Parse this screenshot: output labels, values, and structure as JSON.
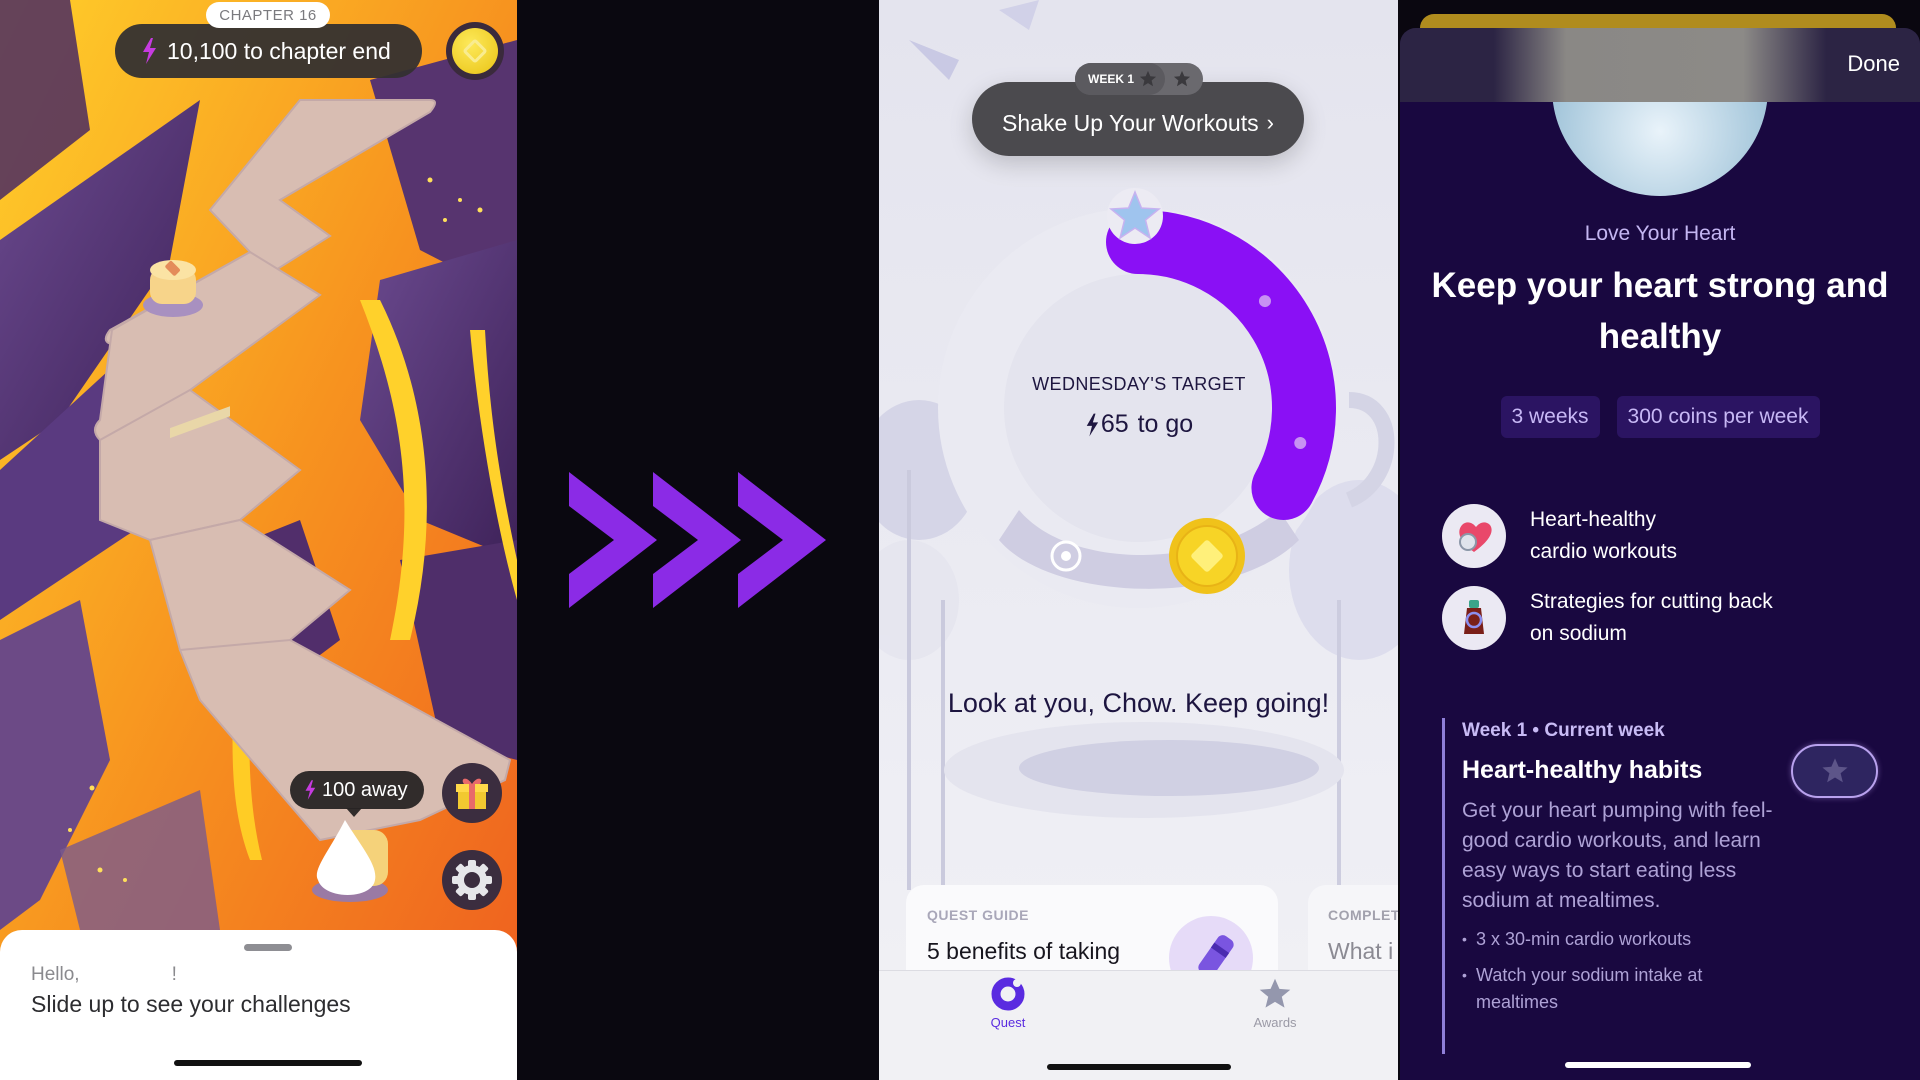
{
  "game": {
    "chapter_label": "CHAPTER 16",
    "progress_text": "10,100 to chapter end",
    "away_text": "100 away",
    "coin_button_icon": "coin-icon",
    "gift_button_icon": "gift-icon",
    "settings_button_icon": "gear-icon",
    "sheet": {
      "greeting": "Hello,",
      "greeting_suffix": "!",
      "prompt": "Slide up to see your challenges"
    },
    "accent_bolt_color": "#c63be0"
  },
  "divider": {
    "icon": "triple-chevron-right-icon",
    "color": "#8b2be6"
  },
  "quest": {
    "week_label": "WEEK 1",
    "title": "Shake Up Your Workouts",
    "title_chevron": "›",
    "target_label": "WEDNESDAY'S TARGET",
    "togo_value": "65",
    "togo_suffix": " to go",
    "ring_progress_fraction": 0.33,
    "ring_color": "#8a10f5",
    "encouragement": "Look at you, Chow. Keep going!",
    "cards": [
      {
        "kicker": "QUEST GUIDE",
        "title": "5 benefits of taking"
      },
      {
        "kicker": "COMPLET",
        "title": "What i"
      }
    ],
    "tabs": [
      {
        "label": "Quest",
        "icon": "quest-ring-icon",
        "active": true
      },
      {
        "label": "Awards",
        "icon": "star-icon",
        "active": false
      }
    ]
  },
  "challenge": {
    "done_label": "Done",
    "eyebrow": "Love Your Heart",
    "headline": "Keep your heart strong and healthy",
    "chips": [
      "3 weeks",
      "300 coins per week"
    ],
    "features": [
      {
        "icon": "heart-stopwatch-icon",
        "text_line1": "Heart-healthy",
        "text_line2": "cardio workouts"
      },
      {
        "icon": "soy-sauce-magnifier-icon",
        "text_line1": "Strategies for cutting back",
        "text_line2": "on sodium"
      }
    ],
    "week": {
      "label": "Week 1 • Current week",
      "title": "Heart-healthy habits",
      "description": "Get your heart pumping with feel-good cardio workouts, and learn easy ways to start eating less sodium at mealtimes.",
      "bullets": [
        "3 x 30-min cardio workouts",
        "Watch your sodium intake at mealtimes"
      ]
    }
  }
}
